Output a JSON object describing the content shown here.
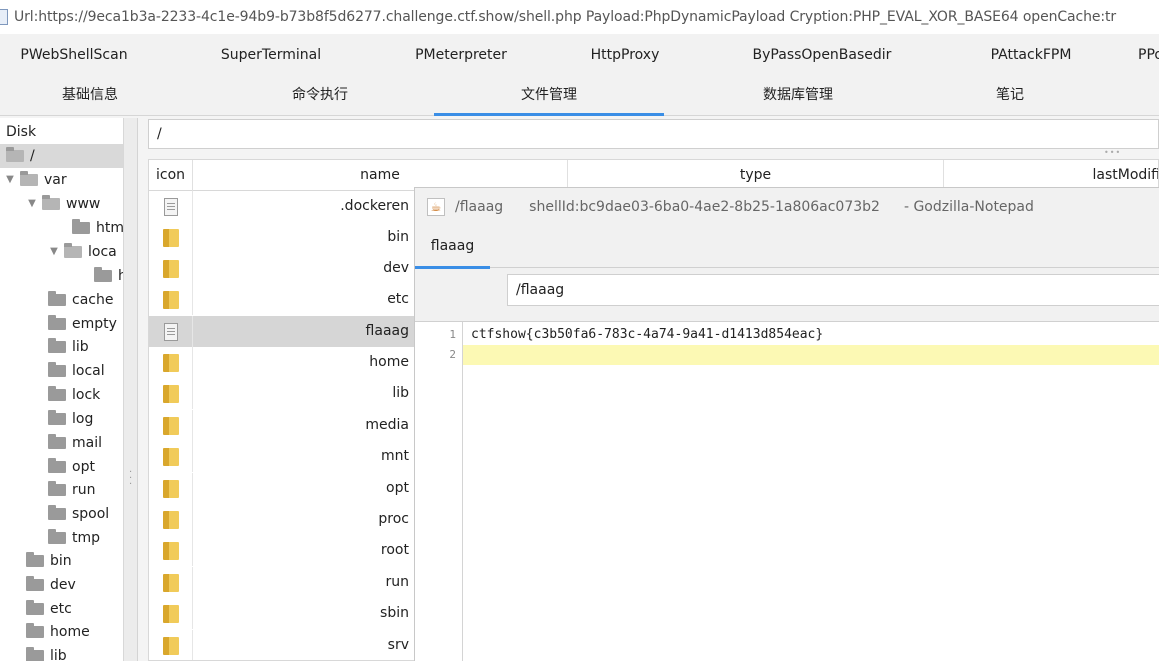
{
  "window": {
    "title": "Url:https://9eca1b3a-2233-4c1e-94b9-b73b8f5d6277.challenge.ctf.show/shell.php Payload:PhpDynamicPayload Cryption:PHP_EVAL_XOR_BASE64 openCache:tr"
  },
  "plugin_tabs": [
    "PWebShellScan",
    "SuperTerminal",
    "PMeterpreter",
    "HttpProxy",
    "ByPassOpenBasedir",
    "PAttackFPM",
    "PPo"
  ],
  "main_tabs": [
    "基础信息",
    "命令执行",
    "文件管理",
    "数据库管理",
    "笔记"
  ],
  "main_tabs_active": "文件管理",
  "tree": {
    "root_label": "Disk",
    "items": [
      {
        "label": "/",
        "depth": 0,
        "expanded": true,
        "selected": true
      },
      {
        "label": "var",
        "depth": 1,
        "expanded": true
      },
      {
        "label": "www",
        "depth": 2,
        "expanded": true
      },
      {
        "label": "htm",
        "depth": 3
      },
      {
        "label": "loca",
        "depth": 3,
        "expanded": true
      },
      {
        "label": "h",
        "depth": 4
      },
      {
        "label": "cache",
        "depth": 2
      },
      {
        "label": "empty",
        "depth": 2
      },
      {
        "label": "lib",
        "depth": 2
      },
      {
        "label": "local",
        "depth": 2
      },
      {
        "label": "lock",
        "depth": 2
      },
      {
        "label": "log",
        "depth": 2
      },
      {
        "label": "mail",
        "depth": 2
      },
      {
        "label": "opt",
        "depth": 2
      },
      {
        "label": "run",
        "depth": 2
      },
      {
        "label": "spool",
        "depth": 2
      },
      {
        "label": "tmp",
        "depth": 2
      },
      {
        "label": "bin",
        "depth": 1
      },
      {
        "label": "dev",
        "depth": 1
      },
      {
        "label": "etc",
        "depth": 1
      },
      {
        "label": "home",
        "depth": 1
      },
      {
        "label": "lib",
        "depth": 1
      }
    ]
  },
  "path_value": "/",
  "file_table": {
    "columns": [
      "icon",
      "name",
      "type",
      "lastModifi"
    ],
    "rows": [
      {
        "name": ".dockeren",
        "kind": "file"
      },
      {
        "name": "bin",
        "kind": "dir"
      },
      {
        "name": "dev",
        "kind": "dir"
      },
      {
        "name": "etc",
        "kind": "dir"
      },
      {
        "name": "flaaag",
        "kind": "file",
        "selected": true
      },
      {
        "name": "home",
        "kind": "dir"
      },
      {
        "name": "lib",
        "kind": "dir"
      },
      {
        "name": "media",
        "kind": "dir"
      },
      {
        "name": "mnt",
        "kind": "dir"
      },
      {
        "name": "opt",
        "kind": "dir"
      },
      {
        "name": "proc",
        "kind": "dir"
      },
      {
        "name": "root",
        "kind": "dir"
      },
      {
        "name": "run",
        "kind": "dir"
      },
      {
        "name": "sbin",
        "kind": "dir"
      },
      {
        "name": "srv",
        "kind": "dir"
      }
    ]
  },
  "notepad": {
    "file": "/flaaag",
    "shell_id": "shellId:bc9dae03-6ba0-4ae2-8b25-1a806ac073b2",
    "app": "- Godzilla-Notepad",
    "tab_label": "flaaag",
    "path_value": "/flaaag",
    "lines": [
      {
        "num": "1",
        "text": "ctfshow{c3b50fa6-783c-4a74-9a41-d1413d854eac}"
      },
      {
        "num": "2",
        "text": ""
      }
    ]
  }
}
